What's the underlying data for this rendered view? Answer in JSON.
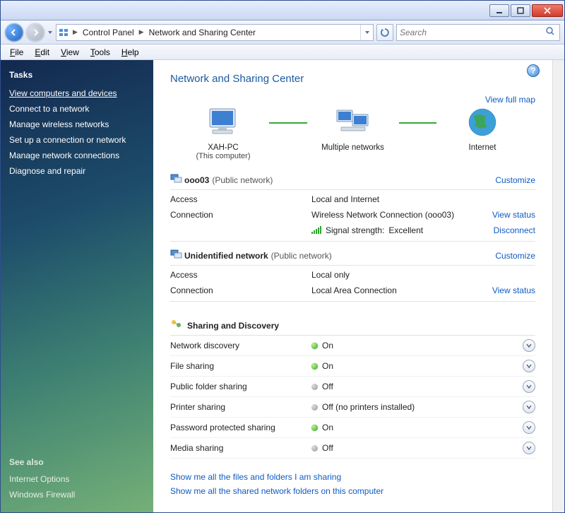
{
  "titlebar": {
    "min": "_",
    "max": "▭",
    "close": "✕"
  },
  "nav": {
    "crumbs": [
      "Control Panel",
      "Network and Sharing Center"
    ],
    "search_placeholder": "Search"
  },
  "menu": {
    "file": "File",
    "edit": "Edit",
    "view": "View",
    "tools": "Tools",
    "help": "Help"
  },
  "sidebar": {
    "tasks_heading": "Tasks",
    "tasks": [
      "View computers and devices",
      "Connect to a network",
      "Manage wireless networks",
      "Set up a connection or network",
      "Manage network connections",
      "Diagnose and repair"
    ],
    "seealso_heading": "See also",
    "seealso": [
      "Internet Options",
      "Windows Firewall"
    ]
  },
  "page_title": "Network and Sharing Center",
  "map": {
    "full_map": "View full map",
    "pc_name": "XAH-PC",
    "pc_sub": "(This computer)",
    "middle": "Multiple networks",
    "internet": "Internet"
  },
  "net1": {
    "name": "ooo03",
    "type": "(Public network)",
    "customize": "Customize",
    "access_label": "Access",
    "access_value": "Local and Internet",
    "conn_label": "Connection",
    "conn_value": "Wireless Network Connection (ooo03)",
    "view_status": "View status",
    "signal_label": "Signal strength:",
    "signal_value": "Excellent",
    "disconnect": "Disconnect"
  },
  "net2": {
    "name": "Unidentified network",
    "type": "(Public network)",
    "customize": "Customize",
    "access_label": "Access",
    "access_value": "Local only",
    "conn_label": "Connection",
    "conn_value": "Local Area Connection",
    "view_status": "View status"
  },
  "sd": {
    "heading": "Sharing and Discovery",
    "rows": [
      {
        "label": "Network discovery",
        "state": "on",
        "text": "On"
      },
      {
        "label": "File sharing",
        "state": "on",
        "text": "On"
      },
      {
        "label": "Public folder sharing",
        "state": "off",
        "text": "Off"
      },
      {
        "label": "Printer sharing",
        "state": "off",
        "text": "Off (no printers installed)"
      },
      {
        "label": "Password protected sharing",
        "state": "on",
        "text": "On"
      },
      {
        "label": "Media sharing",
        "state": "off",
        "text": "Off"
      }
    ]
  },
  "bottom": {
    "link1": "Show me all the files and folders I am sharing",
    "link2": "Show me all the shared network folders on this computer"
  }
}
